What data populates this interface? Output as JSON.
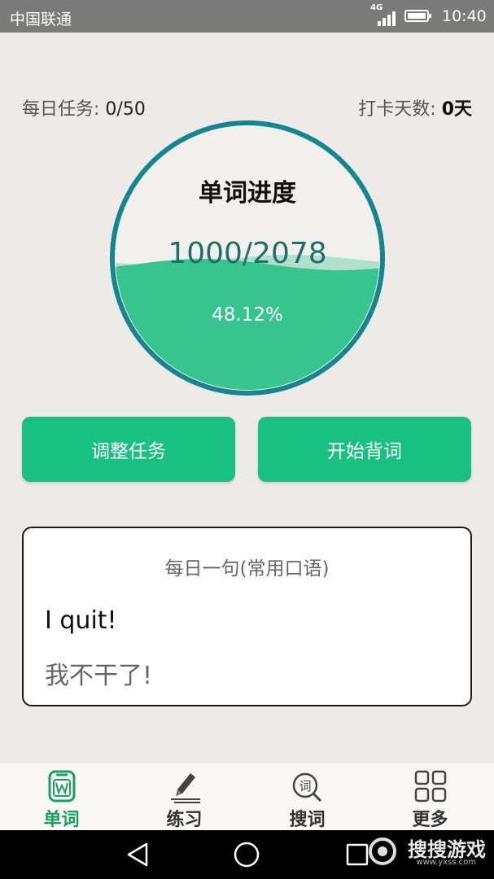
{
  "status_bar": {
    "carrier": "中国联通",
    "network": "4G",
    "time": "10:40"
  },
  "stats": {
    "daily_task_label": "每日任务: ",
    "daily_task_value": "0/50",
    "checkin_label": "打卡天数: ",
    "checkin_value": "0天"
  },
  "progress": {
    "title": "单词进度",
    "count": "1000/2078",
    "percent_text": "48.12%",
    "fraction": 0.4812
  },
  "buttons": {
    "adjust": "调整任务",
    "start": "开始背词"
  },
  "daily_sentence": {
    "title": "每日一句(常用口语)",
    "english": "I quit!",
    "chinese": "我不干了!"
  },
  "bottom_nav": {
    "items": [
      {
        "label": "单词",
        "icon": "word-book-icon",
        "active": true
      },
      {
        "label": "练习",
        "icon": "pencil-icon",
        "active": false
      },
      {
        "label": "搜词",
        "icon": "search-word-icon",
        "active": false
      },
      {
        "label": "更多",
        "icon": "grid-icon",
        "active": false
      }
    ]
  },
  "watermark": {
    "text": "搜搜游戏",
    "url": "www.yxss.com"
  },
  "colors": {
    "accent": "#1abf82",
    "ring": "#17848f",
    "wave": "#37c48e"
  }
}
